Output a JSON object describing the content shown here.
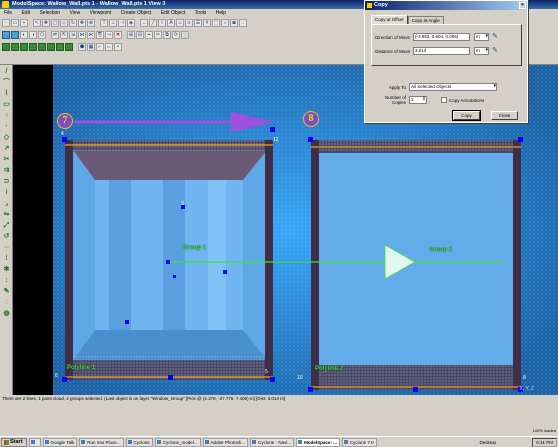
{
  "window": {
    "title": "ModelSpace: Wallow_Wall.pts 1 - Wallow_Wall.pts 1 View 3"
  },
  "menu": [
    "File",
    "Edit",
    "Selection",
    "View",
    "Viewpoint",
    "Create Object",
    "Edit Object",
    "Tools",
    "Help"
  ],
  "viewport": {
    "badge_left": "7",
    "badge_right": "8",
    "group_left_label": "Group 1",
    "group_right_label": "Group 2",
    "polyline_left_label": "Polyline 1",
    "polyline_right_label": "Polyline 2",
    "vertex_numbers": [
      "4",
      "3",
      "6",
      "5",
      "12",
      "10",
      "8"
    ],
    "axis_label": "X, Y, Z"
  },
  "status": {
    "text": "There are 2 lines, 1 point cloud, 2 groups selected. (Last object is on layer \"Window_Group\" [Pick @ (2.378, -27.775, 7.406) m] [Dist: 3.014 m]",
    "loaded": "100% loaded"
  },
  "dialog": {
    "title": "Copy",
    "close_glyph": "×",
    "tabs": [
      "Copy at Offset",
      "Copy at Angle"
    ],
    "direction_label": "Direction of Move",
    "direction_value": "(-2.953, 0.604, 0.005)",
    "direction_unit": "m",
    "distance_label": "Distance of Move",
    "distance_value": "3.014",
    "distance_unit": "m",
    "apply_label": "Apply To",
    "apply_value": "All Selected Objects",
    "copies_label": "Number of Copies",
    "copies_value": "1",
    "annotations_label": "Copy Annotations",
    "copy_button": "Copy",
    "close_button": "Close"
  },
  "taskbar": {
    "start": "Start",
    "items": [
      "",
      "Google Talk",
      "Run Into Plove...",
      "Cyclone",
      "Cyclone_model...",
      "Adobe Photosh...",
      "Cyclone - Navi...",
      "ModelSpace: ...",
      "Cyclone 7.0"
    ],
    "active_index": 7,
    "desktop": "Desktop",
    "clock": "5:31 PM"
  },
  "colors": {
    "viewport_bg": "#2a80d0",
    "group_label": "#3ee03e",
    "selection": "#0000ff",
    "move_arrow": "#a050e0"
  }
}
